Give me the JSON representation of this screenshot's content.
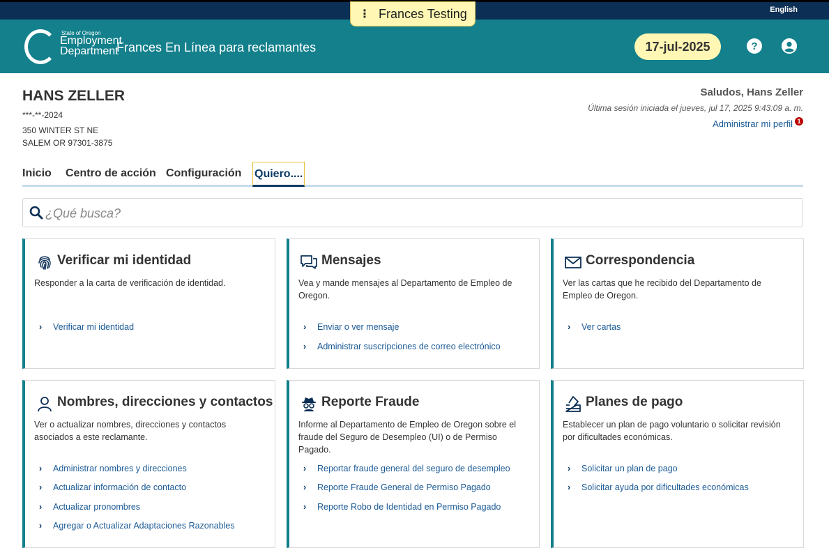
{
  "env": {
    "label": "Frances Testing"
  },
  "language": "English",
  "header": {
    "logo_line1": "State of Oregon",
    "logo_line2": "Employment",
    "logo_line3": "Department",
    "title": "Frances En Línea para reclamantes",
    "date": "17-jul-2025",
    "help_icon": "?"
  },
  "claimant": {
    "name": "HANS ZELLER",
    "ssn": "***-**-2024",
    "address_line1": "350 WINTER ST NE",
    "address_line2": "SALEM OR 97301-3875"
  },
  "session": {
    "greeting": "Saludos, Hans Zeller",
    "last_login": "Última sesión iniciada el jueves, jul 17, 2025 9:43:09 a. m.",
    "profile_link": "Administrar mi perfil",
    "profile_badge": "1"
  },
  "tabs": [
    {
      "label": "Inicio"
    },
    {
      "label": "Centro de acción"
    },
    {
      "label": "Configuración"
    },
    {
      "label": "Quiero...."
    }
  ],
  "search": {
    "placeholder": "¿Qué busca?"
  },
  "cards": [
    {
      "icon": "fingerprint-icon",
      "title": "Verificar mi identidad",
      "description": "Responder a la carta de verificación de identidad.",
      "links": [
        "Verificar mi identidad"
      ]
    },
    {
      "icon": "messages-icon",
      "title": "Mensajes",
      "description": "Vea y mande mensajes al Departamento de Empleo de Oregon.",
      "links": [
        "Enviar o ver mensaje",
        "Administrar suscripciones de correo electrónico"
      ]
    },
    {
      "icon": "envelope-icon",
      "title": "Correspondencia",
      "description": "Ver las cartas que he recibido del Departamento de Empleo de Oregon.",
      "links": [
        "Ver cartas"
      ]
    },
    {
      "icon": "person-icon",
      "title": "Nombres, direcciones y contactos",
      "description": "Ver o actualizar nombres, direcciones y contactos asociados a este reclamante.",
      "links": [
        "Administrar nombres y direcciones",
        "Actualizar información de contacto",
        "Actualizar pronombres",
        "Agregar o Actualizar Adaptaciones Razonables"
      ]
    },
    {
      "icon": "spy-icon",
      "title": "Reporte Fraude",
      "description": "Informe al Departamento de Empleo de Oregon sobre el fraude del Seguro de Desempleo (UI) o de Permiso Pagado.",
      "links": [
        "Reportar fraude general del seguro de desempleo",
        "Reporte Fraude General de Permiso Pagado",
        "Reporte Robo de Identidad en Permiso Pagado"
      ]
    },
    {
      "icon": "ballot-icon",
      "title": "Planes de pago",
      "description": "Establecer un plan de pago voluntario o solicitar revisión por dificultades económicas.",
      "links": [
        "Solicitar un plan de pago",
        "Solicitar ayuda por dificultades económicas"
      ]
    }
  ],
  "colors": {
    "teal": "#13808c",
    "navy": "#0b2f55",
    "link": "#1a5a96",
    "highlight": "#fff7b3"
  }
}
